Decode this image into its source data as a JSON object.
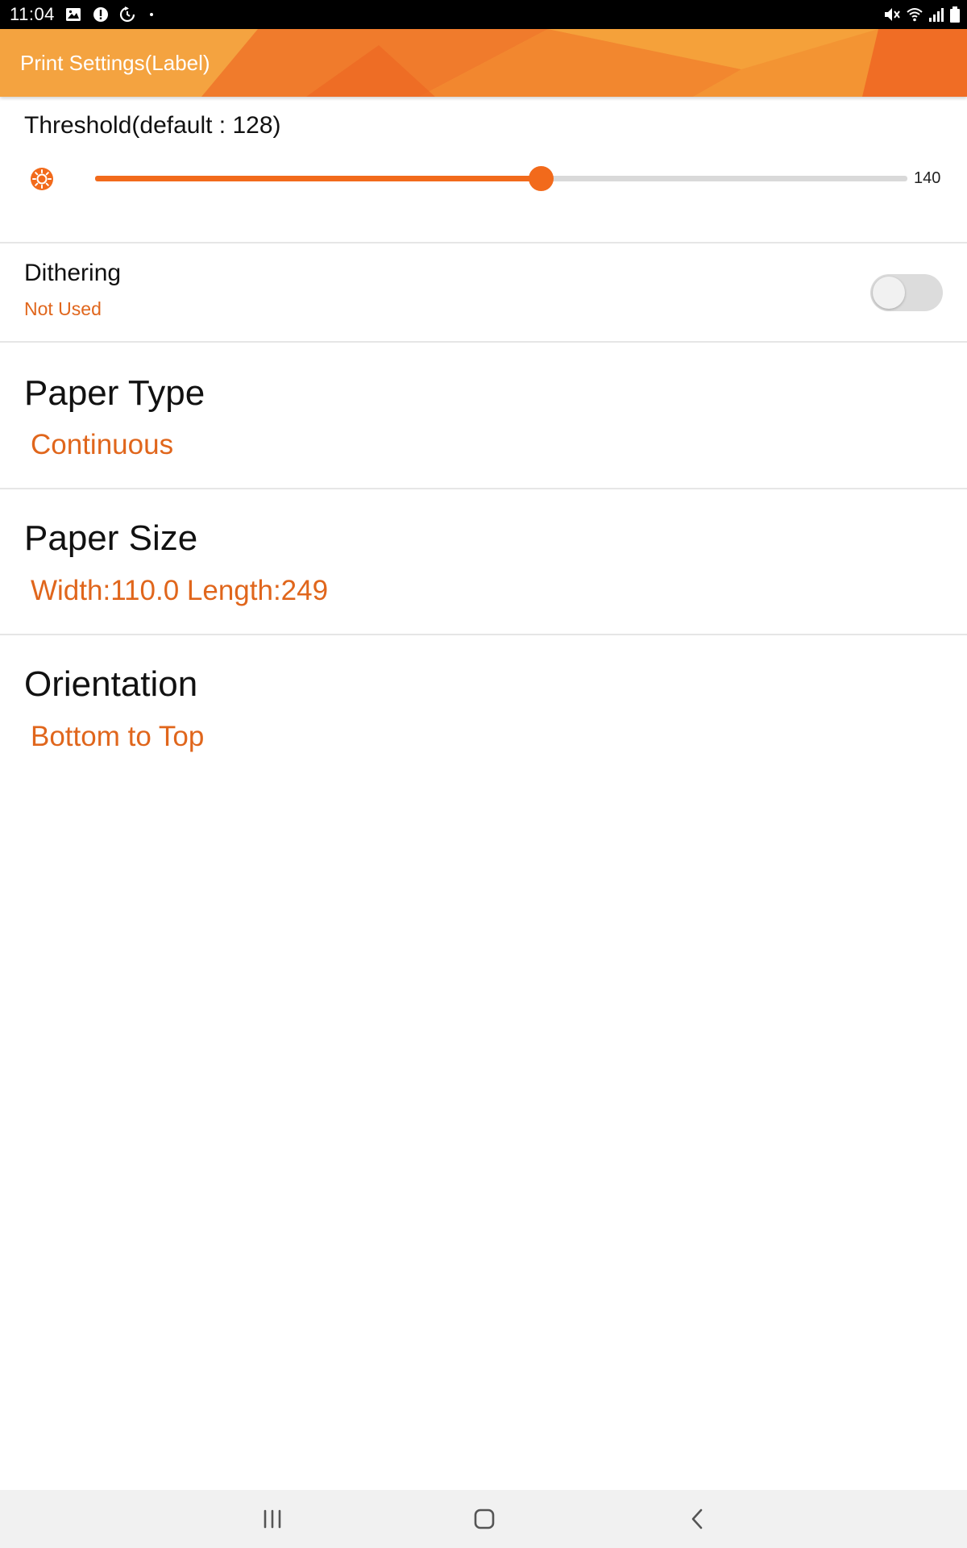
{
  "status_bar": {
    "time": "11:04",
    "left_icons": [
      "gallery-icon",
      "alert-icon",
      "sync-icon"
    ],
    "right_icons": [
      "mute-icon",
      "wifi-icon",
      "signal-icon",
      "battery-icon"
    ]
  },
  "app_bar": {
    "title": "Print Settings(Label)"
  },
  "threshold": {
    "label": "Threshold(default : 128)",
    "value": 140,
    "value_text": "140",
    "min": 0,
    "max": 255,
    "icon": "brightness-icon"
  },
  "dithering": {
    "title": "Dithering",
    "status": "Not Used",
    "enabled": false
  },
  "settings": [
    {
      "title": "Paper Type",
      "value": "Continuous"
    },
    {
      "title": "Paper Size",
      "value": "Width:110.0 Length:249"
    },
    {
      "title": "Orientation",
      "value": "Bottom to Top"
    }
  ],
  "nav_bar": {
    "buttons": [
      "recent-apps-icon",
      "home-icon",
      "back-icon"
    ]
  },
  "colors": {
    "accent": "#f26a1b",
    "accent_text": "#e0661c",
    "app_bar_light": "#f5a13a",
    "app_bar_dark": "#ef6a24"
  }
}
